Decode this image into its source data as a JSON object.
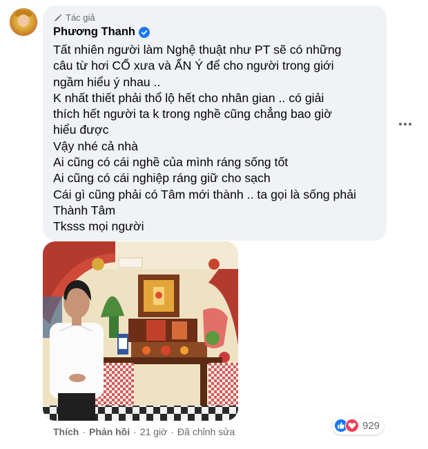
{
  "comment": {
    "badge": "Tác giả",
    "author": "Phương Thanh",
    "lines": [
      "Tất nhiên người làm Nghệ thuật như PT sẽ có những",
      "câu từ hơi CỔ xưa và ẨN Ý để cho người trong giới",
      "ngầm hiểu ý nhau ..",
      "K nhất thiết phải thổ lộ hết cho nhân gian .. có giải",
      "thích hết người ta k trong nghề cũng chẳng bao giờ",
      "hiểu được",
      "Vậy nhé cả nhà",
      "Ai cũng có cái nghề của mình ráng sống tốt",
      "Ai cũng có cái nghiệp ráng giữ cho sạch",
      "Cái gì cũng phải có Tâm mới thành .. ta gọi là sống phải",
      "Thành Tâm",
      "Tksss mọi người"
    ]
  },
  "actions": {
    "like": "Thích",
    "reply": "Phản hồi",
    "time": "21 giờ",
    "edited": "Đã chỉnh sửa",
    "separator": "·"
  },
  "reactions": {
    "count": "929",
    "types": [
      "like-icon",
      "love-icon"
    ]
  },
  "colors": {
    "bubble": "#f0f2f5",
    "secondary_text": "#65676b",
    "facebook_blue": "#1877f2",
    "love_red": "#f33e58"
  }
}
